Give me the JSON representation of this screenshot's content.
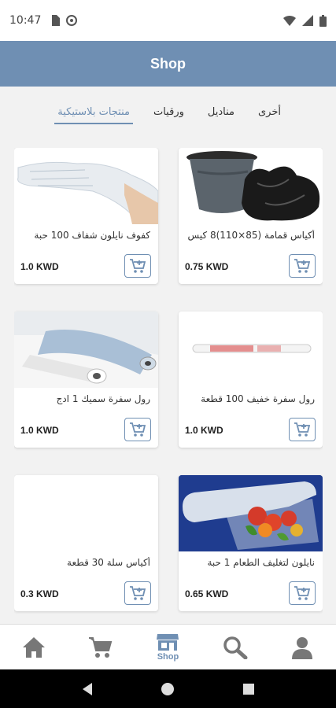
{
  "status_bar": {
    "time": "10:47"
  },
  "app_bar": {
    "title": "Shop"
  },
  "tabs": [
    {
      "label": "منتجات بلاستيكية",
      "active": true
    },
    {
      "label": "ورقيات",
      "active": false
    },
    {
      "label": "مناديل",
      "active": false
    },
    {
      "label": "أخرى",
      "active": false
    }
  ],
  "products": [
    {
      "name": "أكياس قمامة (85×110)8 كيس",
      "price": "0.75 KWD",
      "image": "trash-bags"
    },
    {
      "name": "كفوف نايلون شفاف 100 حبة",
      "price": "1.0 KWD",
      "image": "plastic-gloves"
    },
    {
      "name": "رول سفرة خفيف 100 قطعة",
      "price": "1.0 KWD",
      "image": "table-roll-light"
    },
    {
      "name": "رول سفرة سميك 1 ادج",
      "price": "1.0 KWD",
      "image": "table-roll-thick"
    },
    {
      "name": "نايلون لتغليف الطعام 1 حبة",
      "price": "0.65 KWD",
      "image": "food-wrap"
    },
    {
      "name": "أكياس سلة 30 قطعة",
      "price": "0.3 KWD",
      "image": ""
    }
  ],
  "bottom_nav": {
    "shop_label": "Shop"
  },
  "colors": {
    "primary": "#6f8fb3",
    "background": "#f2f2f2"
  }
}
